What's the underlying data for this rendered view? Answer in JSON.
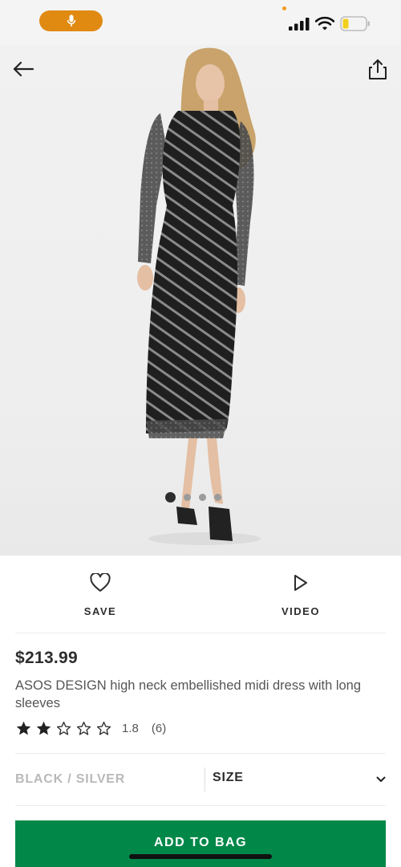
{
  "status_bar": {
    "mic_icon": "microphone-icon",
    "signal_icon": "cellular-signal-icon",
    "wifi_icon": "wifi-icon",
    "battery_icon": "battery-low-icon",
    "pill_color": "#e08a12"
  },
  "hero": {
    "back_icon": "arrow-left-icon",
    "share_icon": "share-icon",
    "carousel": {
      "count": 4,
      "active_index": 0
    }
  },
  "actions": {
    "save_label": "SAVE",
    "video_label": "VIDEO",
    "save_icon": "heart-icon",
    "video_icon": "play-icon"
  },
  "product": {
    "price": "$213.99",
    "title": "ASOS DESIGN high neck embellished midi dress with long sleeves",
    "rating_value": "1.8",
    "rating_count": "(6)",
    "stars_filled": 2,
    "stars_total": 5
  },
  "selectors": {
    "colour": "BLACK / SILVER",
    "size_label": "SIZE",
    "size_icon": "chevron-down-icon"
  },
  "cta": {
    "add_to_bag": "ADD TO BAG",
    "color": "#018849"
  }
}
